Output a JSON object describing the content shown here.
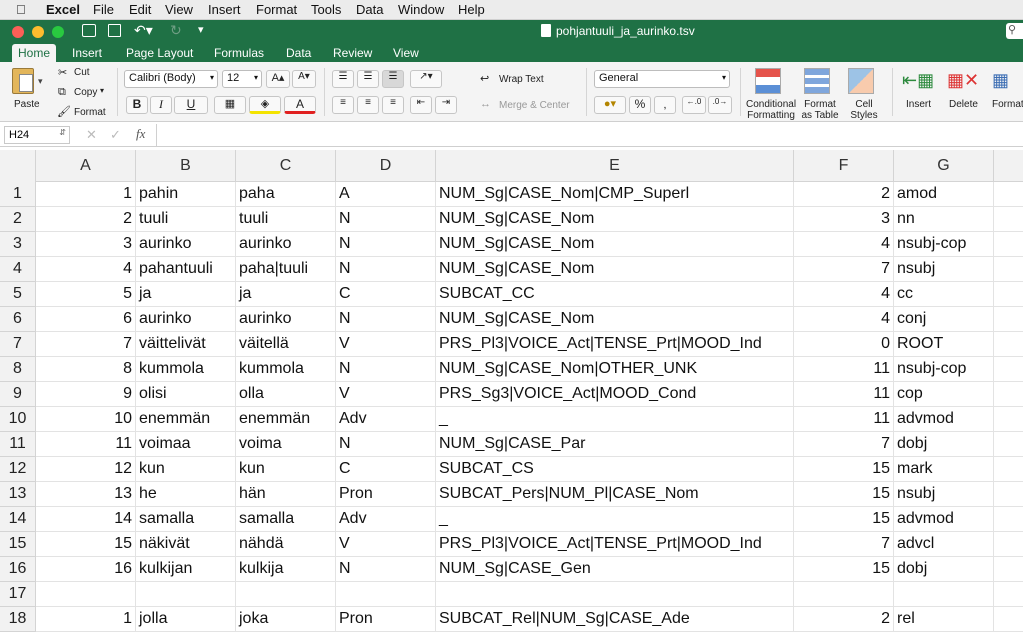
{
  "menubar": {
    "app": "Excel",
    "items": [
      "File",
      "Edit",
      "View",
      "Insert",
      "Format",
      "Tools",
      "Data",
      "Window",
      "Help"
    ]
  },
  "titlebar": {
    "filename": "pohjantuuli_ja_aurinko.tsv"
  },
  "ribbon_tabs": [
    "Home",
    "Insert",
    "Page Layout",
    "Formulas",
    "Data",
    "Review",
    "View"
  ],
  "ribbon": {
    "paste": "Paste",
    "cut": "Cut",
    "copy": "Copy",
    "format": "Format",
    "font_name": "Calibri (Body)",
    "font_size": "12",
    "wrap_text": "Wrap Text",
    "merge_center": "Merge & Center",
    "number_format": "General",
    "conditional_formatting": "Conditional\nFormatting",
    "format_as_table": "Format\nas Table",
    "cell_styles": "Cell\nStyles",
    "insert": "Insert",
    "delete": "Delete",
    "format_cells": "Format"
  },
  "formula_bar": {
    "name_box": "H24",
    "fx": "fx",
    "value": ""
  },
  "columns": [
    "A",
    "B",
    "C",
    "D",
    "E",
    "F",
    "G"
  ],
  "rows": [
    {
      "n": "1",
      "a": "1",
      "b": "pahin",
      "c": "paha",
      "d": "A",
      "e": "NUM_Sg|CASE_Nom|CMP_Superl",
      "f": "2",
      "g": "amod"
    },
    {
      "n": "2",
      "a": "2",
      "b": "tuuli",
      "c": "tuuli",
      "d": "N",
      "e": "NUM_Sg|CASE_Nom",
      "f": "3",
      "g": "nn"
    },
    {
      "n": "3",
      "a": "3",
      "b": "aurinko",
      "c": "aurinko",
      "d": "N",
      "e": "NUM_Sg|CASE_Nom",
      "f": "4",
      "g": "nsubj-cop"
    },
    {
      "n": "4",
      "a": "4",
      "b": "pahantuuli",
      "c": "paha|tuuli",
      "d": "N",
      "e": "NUM_Sg|CASE_Nom",
      "f": "7",
      "g": "nsubj"
    },
    {
      "n": "5",
      "a": "5",
      "b": "ja",
      "c": "ja",
      "d": "C",
      "e": "SUBCAT_CC",
      "f": "4",
      "g": "cc"
    },
    {
      "n": "6",
      "a": "6",
      "b": "aurinko",
      "c": "aurinko",
      "d": "N",
      "e": "NUM_Sg|CASE_Nom",
      "f": "4",
      "g": "conj"
    },
    {
      "n": "7",
      "a": "7",
      "b": "väittelivät",
      "c": "väitellä",
      "d": "V",
      "e": "PRS_Pl3|VOICE_Act|TENSE_Prt|MOOD_Ind",
      "f": "0",
      "g": "ROOT"
    },
    {
      "n": "8",
      "a": "8",
      "b": "kummola",
      "c": "kummola",
      "d": "N",
      "e": "NUM_Sg|CASE_Nom|OTHER_UNK",
      "f": "11",
      "g": "nsubj-cop"
    },
    {
      "n": "9",
      "a": "9",
      "b": "olisi",
      "c": "olla",
      "d": "V",
      "e": "PRS_Sg3|VOICE_Act|MOOD_Cond",
      "f": "11",
      "g": "cop"
    },
    {
      "n": "10",
      "a": "10",
      "b": "enemmän",
      "c": "enemmän",
      "d": "Adv",
      "e": "_",
      "f": "11",
      "g": "advmod"
    },
    {
      "n": "11",
      "a": "11",
      "b": "voimaa",
      "c": "voima",
      "d": "N",
      "e": "NUM_Sg|CASE_Par",
      "f": "7",
      "g": "dobj"
    },
    {
      "n": "12",
      "a": "12",
      "b": "kun",
      "c": "kun",
      "d": "C",
      "e": "SUBCAT_CS",
      "f": "15",
      "g": "mark"
    },
    {
      "n": "13",
      "a": "13",
      "b": "he",
      "c": "hän",
      "d": "Pron",
      "e": "SUBCAT_Pers|NUM_Pl|CASE_Nom",
      "f": "15",
      "g": "nsubj"
    },
    {
      "n": "14",
      "a": "14",
      "b": "samalla",
      "c": "samalla",
      "d": "Adv",
      "e": "_",
      "f": "15",
      "g": "advmod"
    },
    {
      "n": "15",
      "a": "15",
      "b": "näkivät",
      "c": "nähdä",
      "d": "V",
      "e": "PRS_Pl3|VOICE_Act|TENSE_Prt|MOOD_Ind",
      "f": "7",
      "g": "advcl"
    },
    {
      "n": "16",
      "a": "16",
      "b": "kulkijan",
      "c": "kulkija",
      "d": "N",
      "e": "NUM_Sg|CASE_Gen",
      "f": "15",
      "g": "dobj"
    },
    {
      "n": "17",
      "a": "",
      "b": "",
      "c": "",
      "d": "",
      "e": "",
      "f": "",
      "g": ""
    },
    {
      "n": "18",
      "a": "1",
      "b": "jolla",
      "c": "joka",
      "d": "Pron",
      "e": "SUBCAT_Rel|NUM_Sg|CASE_Ade",
      "f": "2",
      "g": "rel"
    }
  ]
}
